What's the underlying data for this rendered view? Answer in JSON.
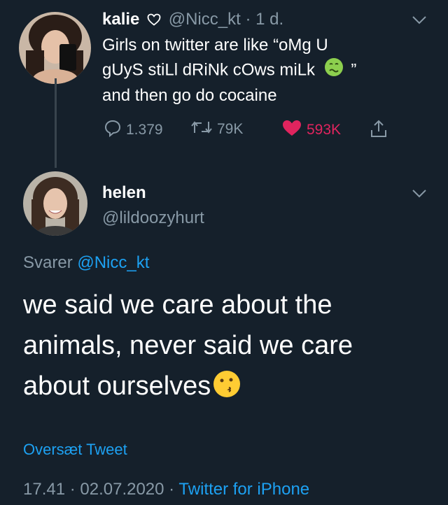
{
  "parent_tweet": {
    "display_name": "kalie",
    "handle": "@Nicc_kt",
    "separator": "·",
    "time": "1 d.",
    "text_line1": "Girls on twitter are like “oMg U",
    "text_line2a": "gUyS stiLl dRiNk cOws miLk",
    "text_line2b": "”",
    "text_line3": "and then go do cocaine",
    "reply_count": "1.379",
    "retweet_count": "79K",
    "like_count": "593K"
  },
  "reply_tweet": {
    "display_name": "helen",
    "handle": "@lildoozyhurt",
    "replying_prefix": "Svarer",
    "replying_to": "@Nicc_kt",
    "text_line1": "we said we care about the",
    "text_line2": "animals, never said we care",
    "text_line3": "about ourselves",
    "translate_label": "Oversæt Tweet",
    "timestamp": "17.41 · 02.07.2020 ·",
    "source": "Twitter for iPhone"
  },
  "icons": {
    "heart_outline": "heart-outline-icon",
    "nauseated": "nauseated-face-emoji",
    "kissing": "kissing-face-emoji"
  },
  "colors": {
    "background": "#15202b",
    "text": "#ffffff",
    "muted": "#8899a6",
    "link": "#1da1f2",
    "like": "#e0245e"
  }
}
